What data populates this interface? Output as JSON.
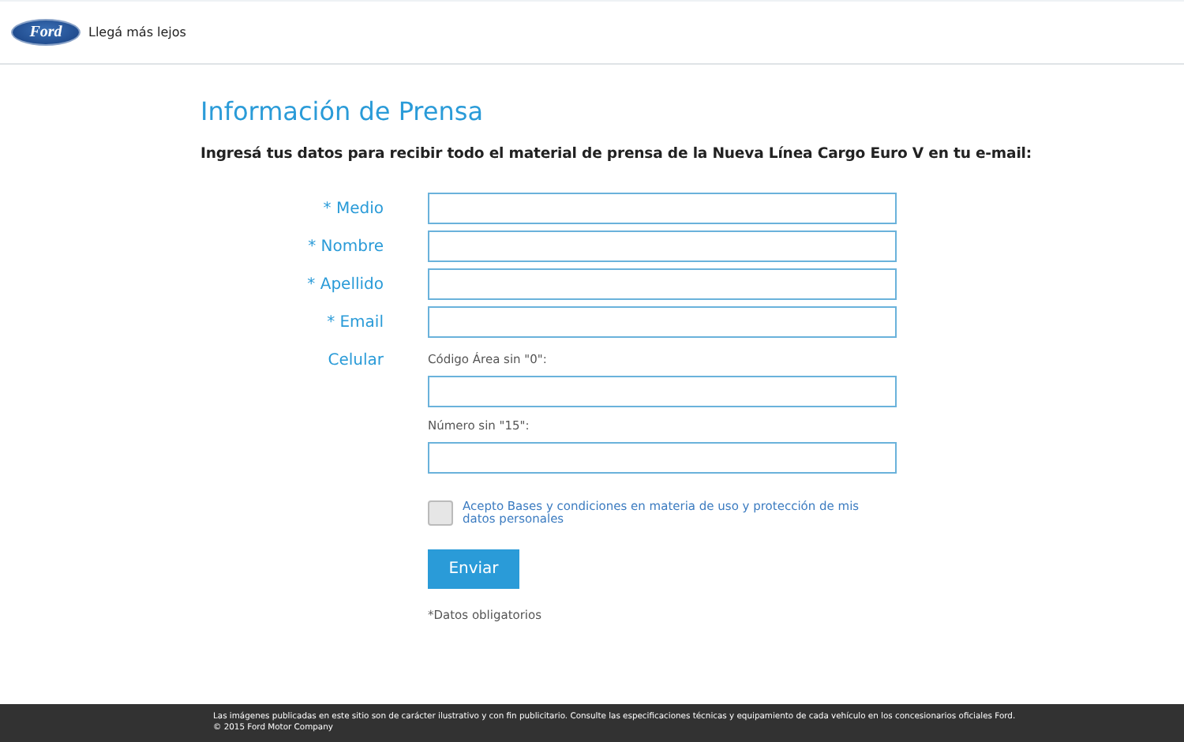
{
  "header": {
    "logo": "Ford",
    "tagline": "Llegá más lejos"
  },
  "title": "Información de Prensa",
  "intro": "Ingresá tus datos para recibir todo el material de prensa de la Nueva Línea Cargo Euro V en tu e-mail:",
  "fields": [
    {
      "label": "* Medio"
    },
    {
      "label": "* Nombre"
    },
    {
      "label": "* Apellido"
    },
    {
      "label": "* Email"
    },
    {
      "label": "Celular",
      "subfields": [
        {
          "label": "Código Área sin \"0\":"
        },
        {
          "label": "Número sin \"15\":"
        }
      ]
    }
  ],
  "terms": {
    "label": "Acepto Bases y condiciones en materia de uso y protección de mis datos personales",
    "checked": false
  },
  "submit": "Enviar",
  "note": "*Datos obligatorios",
  "footer": {
    "disclaimer": "Las imágenes publicadas en este sitio son de carácter ilustrativo y con fin publicitario. Consulte las especificaciones técnicas y equipamiento de cada vehículo en los concesionarios oficiales Ford.",
    "copyright": "© 2015 Ford Motor Company"
  }
}
